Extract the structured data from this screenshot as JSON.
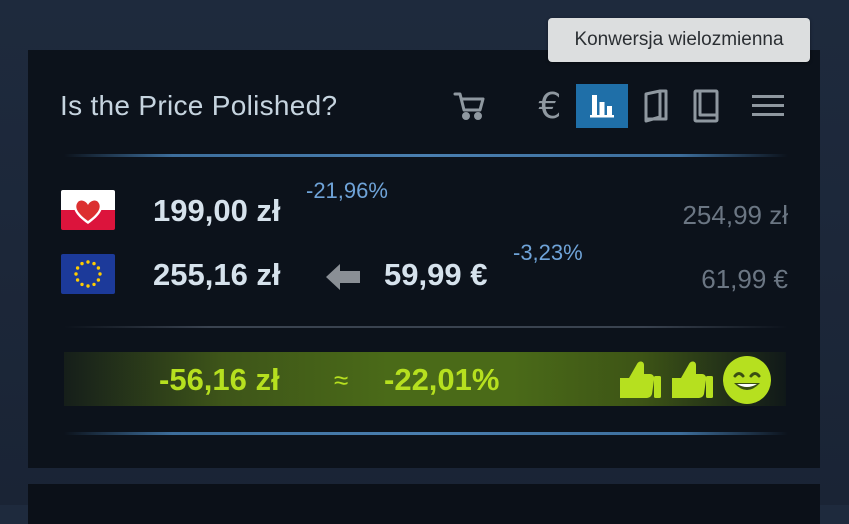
{
  "header": {
    "title": "Is the Price Polished?",
    "toolbar": [
      {
        "name": "cart-icon",
        "active": false
      },
      {
        "name": "euro-icon",
        "active": false
      },
      {
        "name": "bar-chart-icon",
        "active": true
      },
      {
        "name": "book-open-icon",
        "active": false
      },
      {
        "name": "book-icon",
        "active": false
      }
    ],
    "menu_icon": "hamburger-menu-icon",
    "tooltip": "Konwersja wielozmienna"
  },
  "local": {
    "flag": "poland-flag-heart",
    "price": "199,00 zł",
    "discount": "-21,96%",
    "old_price": "254,99 zł"
  },
  "euro": {
    "flag": "eu-flag",
    "converted": "255,16 zł",
    "arrow_icon": "arrow-left-icon",
    "price": "59,99 €",
    "discount": "-3,23%",
    "old_price": "61,99 €"
  },
  "summary": {
    "difference": "-56,16 zł",
    "approx": "≈",
    "percent": "-22,01%",
    "icons": [
      "thumbs-up-icon",
      "thumbs-up-icon",
      "smile-icon"
    ]
  },
  "colors": {
    "accent_blue": "#1f6fa8",
    "good_green": "#b6e01f",
    "discount_blue": "#6fa3d8"
  }
}
